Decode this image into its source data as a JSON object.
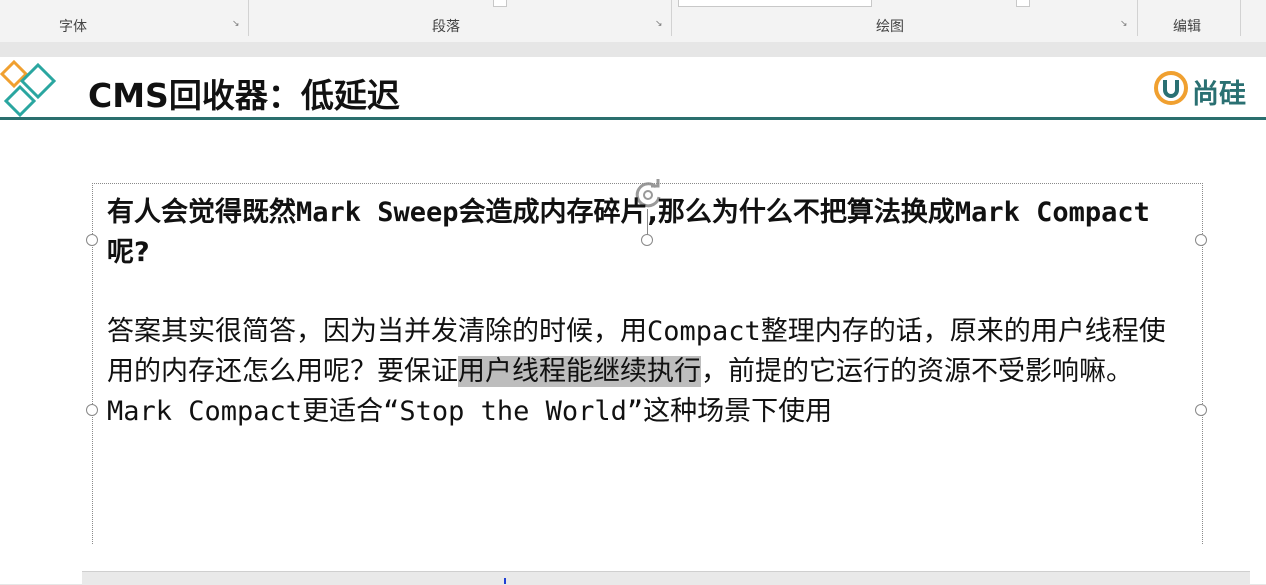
{
  "ribbon": {
    "groups": [
      {
        "label": "字体"
      },
      {
        "label": "段落"
      },
      {
        "label": "绘图"
      },
      {
        "label": "编辑"
      }
    ],
    "launcher_glyph": "↘"
  },
  "slide": {
    "title": "CMS回收器：低延迟",
    "brand": "尚硅",
    "question_parts": [
      "有人会觉得既然",
      "Mark Sweep",
      "会造成内存碎片,那么为什么不把算法换成",
      "Mark Compact",
      "呢?"
    ],
    "answer_parts": {
      "p1": "答案其实很简答，因为当并发清除的时候，用",
      "p2": "Compact",
      "p3": "整理内存的话，原来的用户线程使用的内存还怎么用呢？要保证",
      "highlight": "用户线程能继续执行",
      "p4": "，前提的它运行的资源不受影响嘛。",
      "p5": "Mark Compact",
      "p6": "更适合",
      "p7": "“Stop the World”",
      "p8": "这种场景下使用"
    }
  },
  "colors": {
    "accent_teal": "#2a6f6e",
    "diamond_orange": "#f0a030",
    "diamond_teal": "#2aa6a0",
    "highlight_gray": "#bdbdbd"
  }
}
